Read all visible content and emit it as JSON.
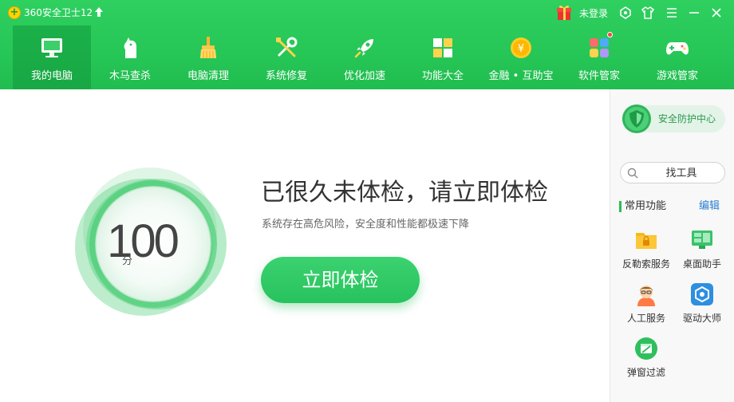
{
  "titlebar": {
    "app_title": "360安全卫士12",
    "logo_glyph": "+",
    "login": "未登录",
    "icons": [
      "upgrade-arrow-icon",
      "gift-icon",
      "skin-icon",
      "shirt-icon",
      "menu-icon",
      "minimize-icon",
      "close-icon"
    ]
  },
  "nav": {
    "items": [
      {
        "label": "我的电脑",
        "icon": "computer-icon",
        "active": true
      },
      {
        "label": "木马查杀",
        "icon": "horse-icon"
      },
      {
        "label": "电脑清理",
        "icon": "broom-icon"
      },
      {
        "label": "系统修复",
        "icon": "wrench-icon"
      },
      {
        "label": "优化加速",
        "icon": "rocket-icon"
      },
      {
        "label": "功能大全",
        "icon": "grid-icon"
      },
      {
        "label": "金融 • 互助宝",
        "icon": "yen-coin-icon"
      },
      {
        "label": "软件管家",
        "icon": "apps-icon",
        "badge": true
      },
      {
        "label": "游戏管家",
        "icon": "gamepad-icon"
      }
    ]
  },
  "main": {
    "score": "100",
    "score_unit": "分",
    "headline": "已很久未体检，请立即体检",
    "subline": "系统存在高危风险，安全度和性能都极速下降",
    "check_button": "立即体检"
  },
  "side": {
    "protect_center": "安全防护中心",
    "search_placeholder": "找工具",
    "section_title": "常用功能",
    "edit": "编辑",
    "tools": [
      {
        "label": "反勒索服务",
        "icon": "folder-lock-icon"
      },
      {
        "label": "桌面助手",
        "icon": "desktop-icon"
      },
      {
        "label": "人工服务",
        "icon": "person-service-icon"
      },
      {
        "label": "驱动大师",
        "icon": "driver-icon"
      },
      {
        "label": "弹窗过滤",
        "icon": "popup-filter-icon"
      }
    ]
  },
  "colors": {
    "brand_green": "#26c657",
    "active_tab": "#18a845",
    "button_green": "#2fc863",
    "link_blue": "#2a7fd4"
  }
}
